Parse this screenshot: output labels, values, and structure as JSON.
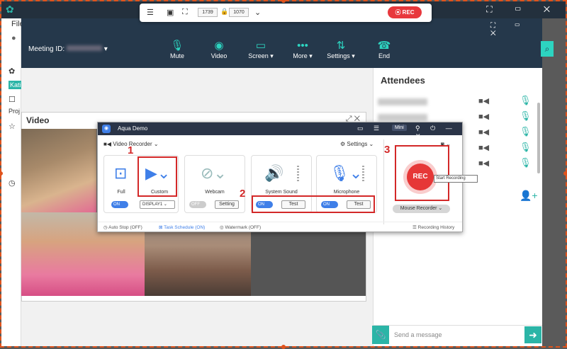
{
  "toolbar": {
    "width_value": "1739",
    "height_value": "1070",
    "rec_label": "REC"
  },
  "outer": {
    "menu_file": "File",
    "left_items": [
      "Kati",
      "Proj"
    ]
  },
  "meeting": {
    "id_label": "Meeting ID:",
    "buttons": [
      {
        "label": "Mute",
        "icon": "mic-icon"
      },
      {
        "label": "Video",
        "icon": "video-icon"
      },
      {
        "label": "Screen ▾",
        "icon": "screen-icon"
      },
      {
        "label": "More ▾",
        "icon": "more-icon"
      },
      {
        "label": "Settings ▾",
        "icon": "settings-icon"
      },
      {
        "label": "End",
        "icon": "phone-icon"
      }
    ]
  },
  "attendees": {
    "title": "Attendees",
    "message_placeholder": "Send a message"
  },
  "video_panel": {
    "title": "Video"
  },
  "recorder": {
    "app_name": "Aqua Demo",
    "mini_label": "Mini",
    "mode_label": "Video Recorder",
    "settings_label": "Settings",
    "full_label": "Full",
    "custom_label": "Custom",
    "webcam_label": "Webcam",
    "system_sound_label": "System Sound",
    "microphone_label": "Microphone",
    "toggle_on": "ON",
    "toggle_off": "OFF",
    "display_value": "DISPLAY1",
    "setting_btn": "Setting",
    "test_btn": "Test",
    "rec_label": "REC",
    "tooltip": "Start Recording",
    "mouse_recorder": "Mouse Recorder",
    "auto_stop": "Auto Stop (OFF)",
    "task_schedule": "Task Schedule (ON)",
    "watermark": "Watermark (OFF)",
    "history": "Recording History"
  },
  "annotations": {
    "n1": "1",
    "n2": "2",
    "n3": "3"
  },
  "colors": {
    "accent": "#2bb5a7",
    "rec_red": "#e63737",
    "highlight": "#d32828",
    "app_blue": "#3f7fe8"
  }
}
